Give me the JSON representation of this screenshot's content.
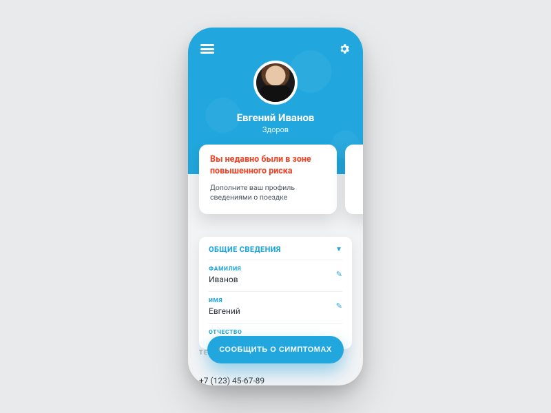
{
  "user": {
    "name": "Евгений Иванов",
    "status": "Здоров"
  },
  "alert": {
    "title": "Вы недавно были в зоне повышенного риска",
    "subtitle": "Дополните ваш профиль сведениями о поездке"
  },
  "section": {
    "title": "ОБЩИЕ СВЕДЕНИЯ",
    "fields": [
      {
        "label": "ФАМИЛИЯ",
        "value": "Иванов"
      },
      {
        "label": "ИМЯ",
        "value": "Евгений"
      },
      {
        "label": "ОТЧЕСТВО",
        "value": ""
      }
    ]
  },
  "partial": {
    "label": "ТЕЛЕФОН",
    "value": "+7 (123) 45-67-89"
  },
  "cta": {
    "label": "СООБЩИТЬ О СИМПТОМАХ"
  }
}
